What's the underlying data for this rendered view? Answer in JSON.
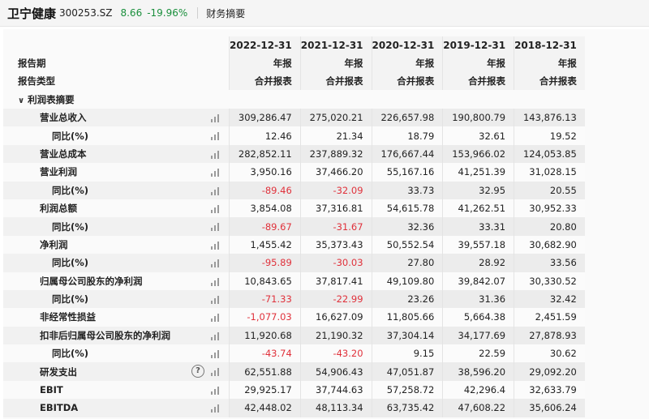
{
  "header": {
    "stock_name": "卫宁健康",
    "stock_code": "300253.SZ",
    "price": "8.66",
    "change": "-19.96%",
    "section": "财务摘要"
  },
  "table": {
    "periods": [
      "2022-12-31",
      "2021-12-31",
      "2020-12-31",
      "2019-12-31",
      "2018-12-31"
    ],
    "report_period_label": "报告期",
    "report_type_label": "报告类型",
    "report_period_values": [
      "年报",
      "年报",
      "年报",
      "年报",
      "年报"
    ],
    "report_type_values": [
      "合并报表",
      "合并报表",
      "合并报表",
      "合并报表",
      "合并报表"
    ],
    "section_label": "利润表摘要",
    "rows": [
      {
        "label": "营业总收入",
        "values": [
          "309,286.47",
          "275,020.21",
          "226,657.98",
          "190,800.79",
          "143,876.13"
        ]
      },
      {
        "label": "同比(%)",
        "values": [
          "12.46",
          "21.34",
          "18.79",
          "32.61",
          "19.52"
        ]
      },
      {
        "label": "营业总成本",
        "values": [
          "282,852.11",
          "237,889.32",
          "176,667.44",
          "153,966.02",
          "124,053.85"
        ]
      },
      {
        "label": "营业利润",
        "values": [
          "3,950.16",
          "37,466.20",
          "55,167.16",
          "41,251.39",
          "31,028.15"
        ]
      },
      {
        "label": "同比(%)",
        "values": [
          "-89.46",
          "-32.09",
          "33.73",
          "32.95",
          "20.55"
        ]
      },
      {
        "label": "利润总额",
        "values": [
          "3,854.08",
          "37,316.81",
          "54,615.78",
          "41,262.51",
          "30,952.33"
        ]
      },
      {
        "label": "同比(%)",
        "values": [
          "-89.67",
          "-31.67",
          "32.36",
          "33.31",
          "20.80"
        ]
      },
      {
        "label": "净利润",
        "values": [
          "1,455.42",
          "35,373.43",
          "50,552.54",
          "39,557.18",
          "30,682.90"
        ]
      },
      {
        "label": "同比(%)",
        "values": [
          "-95.89",
          "-30.03",
          "27.80",
          "28.92",
          "33.56"
        ]
      },
      {
        "label": "归属母公司股东的净利润",
        "values": [
          "10,843.65",
          "37,817.41",
          "49,109.80",
          "39,842.07",
          "30,330.52"
        ]
      },
      {
        "label": "同比(%)",
        "values": [
          "-71.33",
          "-22.99",
          "23.26",
          "31.36",
          "32.42"
        ]
      },
      {
        "label": "非经常性损益",
        "values": [
          "-1,077.03",
          "16,627.09",
          "11,805.66",
          "5,664.38",
          "2,451.59"
        ]
      },
      {
        "label": "扣非后归属母公司股东的净利润",
        "values": [
          "11,920.68",
          "21,190.32",
          "37,304.14",
          "34,177.69",
          "27,878.93"
        ]
      },
      {
        "label": "同比(%)",
        "values": [
          "-43.74",
          "-43.20",
          "9.15",
          "22.59",
          "30.62"
        ]
      },
      {
        "label": "研发支出",
        "values": [
          "62,551.88",
          "54,906.43",
          "47,051.87",
          "38,596.20",
          "29,092.20"
        ]
      },
      {
        "label": "EBIT",
        "values": [
          "29,925.17",
          "37,744.63",
          "57,258.72",
          "42,296.4",
          "32,633.79"
        ]
      },
      {
        "label": "EBITDA",
        "values": [
          "42,448.02",
          "48,113.34",
          "63,735.42",
          "47,608.22",
          "35,606.24"
        ]
      }
    ]
  },
  "colors": {
    "positive_change": "#1a8f3c",
    "negative_value": "#e0313b"
  },
  "icons": {
    "chart": "bar-chart-icon",
    "help": "question-circle-icon",
    "collapse": "chevron-down-icon"
  }
}
